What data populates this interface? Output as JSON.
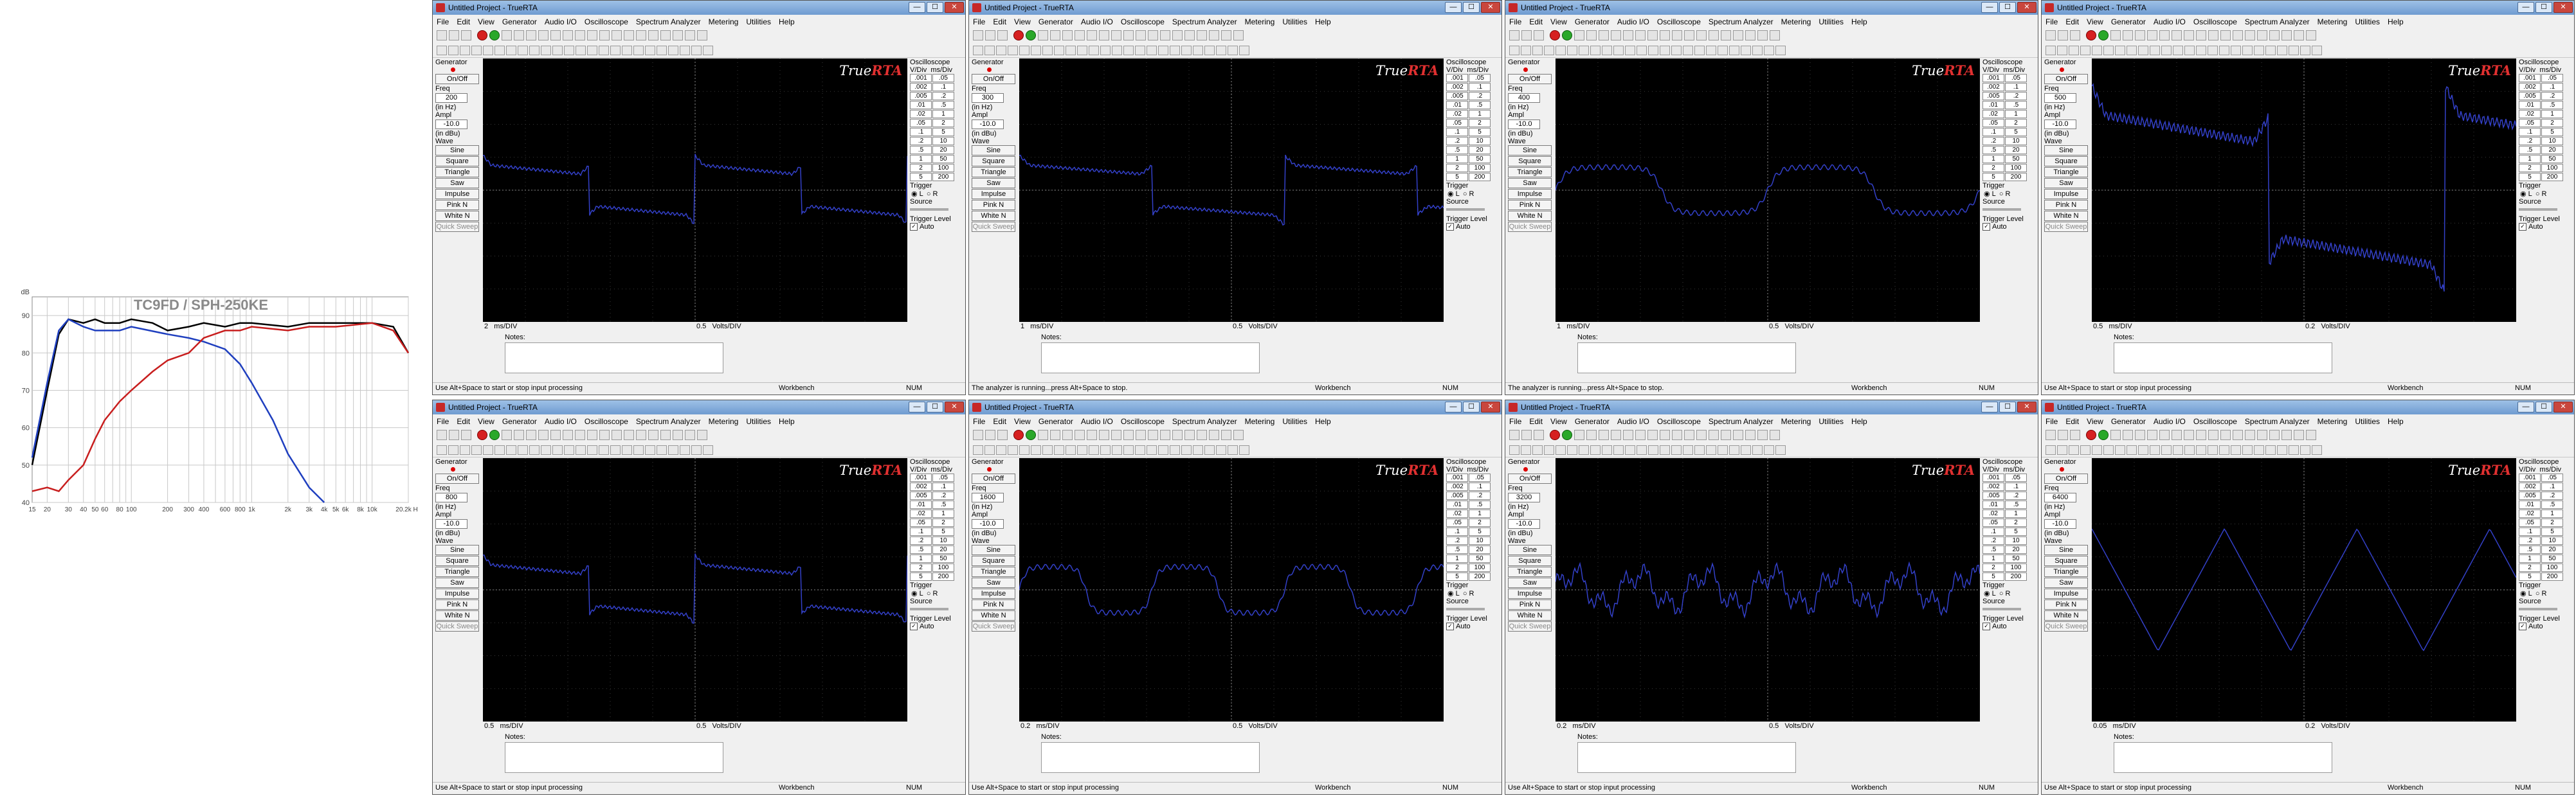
{
  "chart_data": {
    "type": "line",
    "title": "TC9FD / SPH-250KE",
    "ylabel": "dB",
    "ylim": [
      40,
      95
    ],
    "yticks": [
      40,
      50,
      60,
      70,
      80,
      90
    ],
    "xscale": "log",
    "xlim": [
      15,
      20000
    ],
    "xticks": [
      {
        "v": 15,
        "label": "15"
      },
      {
        "v": 20,
        "label": "20"
      },
      {
        "v": 30,
        "label": "30"
      },
      {
        "v": 40,
        "label": "40"
      },
      {
        "v": 50,
        "label": "50"
      },
      {
        "v": 60,
        "label": "60"
      },
      {
        "v": 80,
        "label": "80"
      },
      {
        "v": 100,
        "label": "100"
      },
      {
        "v": 200,
        "label": "200"
      },
      {
        "v": 300,
        "label": "300"
      },
      {
        "v": 400,
        "label": "400"
      },
      {
        "v": 600,
        "label": "600"
      },
      {
        "v": 800,
        "label": "800"
      },
      {
        "v": 1000,
        "label": "1k"
      },
      {
        "v": 2000,
        "label": "2k"
      },
      {
        "v": 3000,
        "label": "3k"
      },
      {
        "v": 4000,
        "label": "4k"
      },
      {
        "v": 5000,
        "label": "5k"
      },
      {
        "v": 6000,
        "label": "6k"
      },
      {
        "v": 8000,
        "label": "8k"
      },
      {
        "v": 10000,
        "label": "10k"
      },
      {
        "v": 20000,
        "label": "20.2k Hz"
      }
    ],
    "grid": true,
    "series": [
      {
        "color": "#000000",
        "points": [
          [
            15,
            50
          ],
          [
            20,
            70
          ],
          [
            25,
            85
          ],
          [
            30,
            89
          ],
          [
            40,
            88
          ],
          [
            50,
            89
          ],
          [
            60,
            88
          ],
          [
            80,
            88
          ],
          [
            100,
            89
          ],
          [
            150,
            88
          ],
          [
            200,
            86
          ],
          [
            300,
            87
          ],
          [
            400,
            88
          ],
          [
            600,
            87
          ],
          [
            800,
            88
          ],
          [
            1000,
            88
          ],
          [
            2000,
            87
          ],
          [
            3000,
            88
          ],
          [
            5000,
            88
          ],
          [
            10000,
            88
          ],
          [
            15000,
            87
          ],
          [
            20000,
            80
          ]
        ]
      },
      {
        "color": "#1f3fbf",
        "points": [
          [
            15,
            52
          ],
          [
            20,
            72
          ],
          [
            25,
            86
          ],
          [
            30,
            89
          ],
          [
            40,
            87
          ],
          [
            50,
            86
          ],
          [
            80,
            86
          ],
          [
            100,
            87
          ],
          [
            200,
            85
          ],
          [
            300,
            84
          ],
          [
            400,
            83
          ],
          [
            600,
            81
          ],
          [
            800,
            77
          ],
          [
            1000,
            72
          ],
          [
            1500,
            62
          ],
          [
            2000,
            53
          ],
          [
            3000,
            44
          ],
          [
            4000,
            40
          ]
        ]
      },
      {
        "color": "#c81e1e",
        "points": [
          [
            15,
            43
          ],
          [
            20,
            44
          ],
          [
            25,
            43
          ],
          [
            30,
            46
          ],
          [
            40,
            50
          ],
          [
            50,
            57
          ],
          [
            60,
            62
          ],
          [
            80,
            67
          ],
          [
            100,
            70
          ],
          [
            150,
            75
          ],
          [
            200,
            78
          ],
          [
            300,
            80
          ],
          [
            400,
            84
          ],
          [
            600,
            86
          ],
          [
            800,
            86
          ],
          [
            1000,
            87
          ],
          [
            2000,
            86
          ],
          [
            3000,
            87
          ],
          [
            5000,
            87
          ],
          [
            10000,
            88
          ],
          [
            15000,
            86
          ],
          [
            20000,
            80
          ]
        ]
      }
    ]
  },
  "windows": [
    {
      "title": "Untitled Project - TrueRTA",
      "freq": "200",
      "ampl": "-10.0",
      "time_div": "2",
      "time_unit": "ms/DIV",
      "volt_div": "0.5",
      "volt_unit": "Volts/DIV",
      "status": "Use Alt+Space to start or stop input processing",
      "wave": "square-rounded",
      "cycles": 2.0
    },
    {
      "title": "Untitled Project - TrueRTA",
      "freq": "300",
      "ampl": "-10.0",
      "time_div": "1",
      "time_unit": "ms/DIV",
      "volt_div": "0.5",
      "volt_unit": "Volts/DIV",
      "status": "The analyzer is running...press Alt+Space to stop.",
      "wave": "square-rounded",
      "cycles": 1.6
    },
    {
      "title": "Untitled Project - TrueRTA",
      "freq": "400",
      "ampl": "-10.0",
      "time_div": "1",
      "time_unit": "ms/DIV",
      "volt_div": "0.5",
      "volt_unit": "Volts/DIV",
      "status": "The analyzer is running...press Alt+Space to stop.",
      "wave": "square-soft",
      "cycles": 2.0
    },
    {
      "title": "Untitled Project - TrueRTA",
      "freq": "500",
      "ampl": "-10.0",
      "time_div": "0.5",
      "time_unit": "ms/DIV",
      "volt_div": "0.2",
      "volt_unit": "Volts/DIV",
      "status": "Use Alt+Space to start or stop input processing",
      "wave": "square-big",
      "cycles": 1.2
    },
    {
      "title": "Untitled Project - TrueRTA",
      "freq": "800",
      "ampl": "-10.0",
      "time_div": "0.5",
      "time_unit": "ms/DIV",
      "volt_div": "0.5",
      "volt_unit": "Volts/DIV",
      "status": "Use Alt+Space to start or stop input processing",
      "wave": "square-rounded",
      "cycles": 2.0
    },
    {
      "title": "Untitled Project - TrueRTA",
      "freq": "1600",
      "ampl": "-10.0",
      "time_div": "0.2",
      "time_unit": "ms/DIV",
      "volt_div": "0.5",
      "volt_unit": "Volts/DIV",
      "status": "Use Alt+Space to start or stop input processing",
      "wave": "square-soft",
      "cycles": 3.2
    },
    {
      "title": "Untitled Project - TrueRTA",
      "freq": "3200",
      "ampl": "-10.0",
      "time_div": "0.2",
      "time_unit": "ms/DIV",
      "volt_div": "0.5",
      "volt_unit": "Volts/DIV",
      "status": "Use Alt+Space to start or stop input processing",
      "wave": "jagged",
      "cycles": 6.4
    },
    {
      "title": "Untitled Project - TrueRTA",
      "freq": "6400",
      "ampl": "-10.0",
      "time_div": "0.05",
      "time_unit": "ms/DIV",
      "volt_div": "0.2",
      "volt_unit": "Volts/DIV",
      "status": "Use Alt+Space to start or stop input processing",
      "wave": "triangle",
      "cycles": 3.2
    }
  ],
  "menu": [
    "File",
    "Edit",
    "View",
    "Generator",
    "Audio I/O",
    "Oscilloscope",
    "Spectrum Analyzer",
    "Metering",
    "Utilities",
    "Help"
  ],
  "generator": {
    "header": "Generator",
    "on_off": "On/Off",
    "freq_label": "Freq",
    "freq_unit": "(in Hz)",
    "ampl_label": "Ampl",
    "ampl_unit": "(in dBu)",
    "wave_label": "Wave",
    "waves": [
      "Sine",
      "Square",
      "Triangle",
      "Saw",
      "Impulse",
      "Pink N",
      "White N"
    ],
    "quick_sweep": "Quick Sweep"
  },
  "scope": {
    "header": "Oscilloscope",
    "vdiv_label": "V/Div",
    "msdiv_label": "ms/Div",
    "vdiv_values": [
      ".001",
      ".002",
      ".005",
      ".01",
      ".02",
      ".05",
      ".1",
      ".2",
      ".5",
      "1",
      "2",
      "5"
    ],
    "msdiv_values": [
      ".05",
      ".1",
      ".2",
      ".5",
      "1",
      "2",
      "5",
      "10",
      "20",
      "50",
      "100",
      "200"
    ],
    "trigger_label": "Trigger",
    "trigger_l": "L",
    "trigger_r": "R",
    "source_label": "Source",
    "trigger_level_label": "Trigger Level",
    "auto_label": "Auto"
  },
  "notes_label": "Notes:",
  "brand": {
    "true": "True",
    "rta": "RTA"
  },
  "status_workbench": "Workbench",
  "status_num": "NUM",
  "window_buttons": {
    "min": "—",
    "max": "☐",
    "close": "✕"
  }
}
